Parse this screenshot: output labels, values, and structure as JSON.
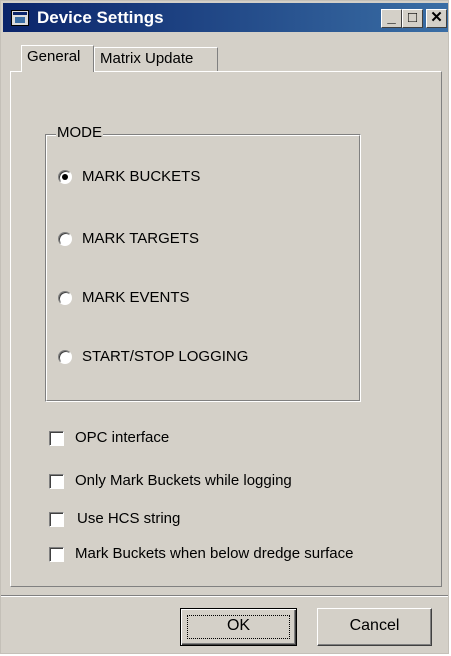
{
  "window": {
    "title": "Device Settings",
    "minimize_label": "_",
    "maximize_label": "□",
    "close_label": "✕"
  },
  "tabs": [
    {
      "label": "General",
      "active": true
    },
    {
      "label": "Matrix Update",
      "active": false
    }
  ],
  "mode_group": {
    "label": "MODE",
    "options": [
      {
        "label": "MARK BUCKETS",
        "checked": true
      },
      {
        "label": "MARK TARGETS",
        "checked": false
      },
      {
        "label": "MARK EVENTS",
        "checked": false
      },
      {
        "label": "START/STOP LOGGING",
        "checked": false
      }
    ]
  },
  "checkboxes": [
    {
      "label": "OPC interface",
      "checked": false
    },
    {
      "label": "Only Mark Buckets while logging",
      "checked": false
    },
    {
      "label": "Use HCS string",
      "checked": false
    },
    {
      "label": "Mark Buckets when below dredge surface",
      "checked": false
    }
  ],
  "buttons": {
    "ok_label": "OK",
    "cancel_label": "Cancel"
  }
}
